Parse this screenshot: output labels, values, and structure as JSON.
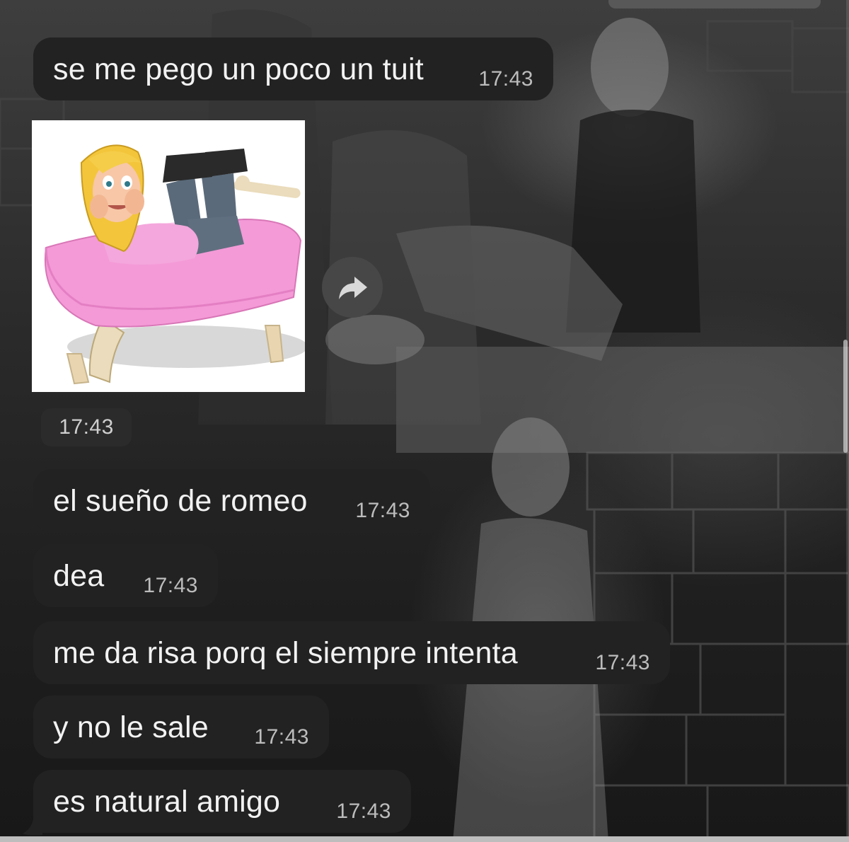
{
  "chat": {
    "messages": [
      {
        "text": "se me pego un poco un tuit",
        "time": "17:43"
      },
      {
        "text": "el sueño de romeo",
        "time": "17:43"
      },
      {
        "text": "dea",
        "time": "17:43"
      },
      {
        "text": "me da risa porq el siempre intenta",
        "time": "17:43"
      },
      {
        "text": "y no le sale",
        "time": "17:43"
      },
      {
        "text": "es natural amigo",
        "time": "17:43"
      }
    ],
    "sticker": {
      "time": "17:43",
      "description_icon": "cartoon-girl-on-bed-sticker"
    },
    "forward_icon": "share-forward-icon"
  },
  "colors": {
    "bubble": "#222222",
    "text": "#f2f2f2",
    "time": "#bcbcbc"
  }
}
